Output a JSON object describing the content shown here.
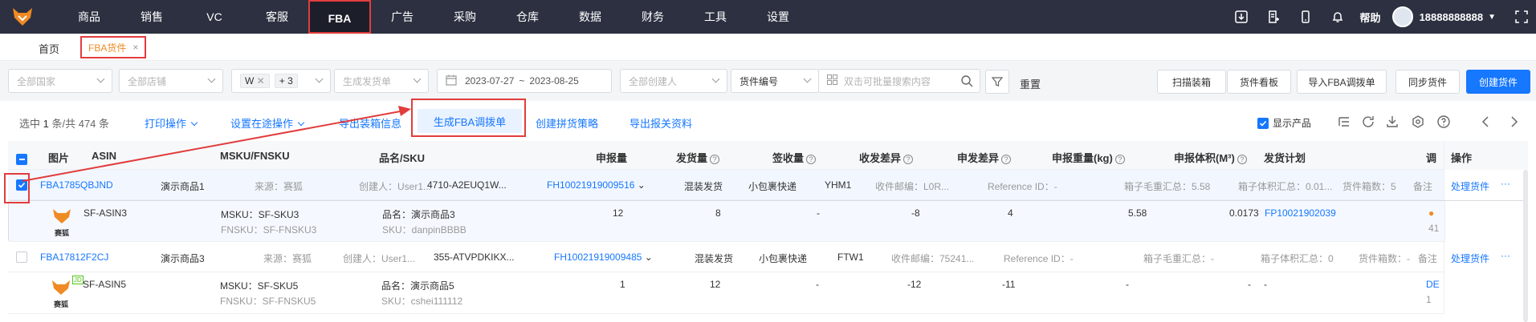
{
  "nav": {
    "items": [
      "商品",
      "销售",
      "VC",
      "客服",
      "FBA",
      "广告",
      "采购",
      "仓库",
      "数据",
      "财务",
      "工具",
      "设置"
    ],
    "active": "FBA",
    "help": "帮助",
    "user": "18888888888"
  },
  "tabs": {
    "home": "首页",
    "current": "FBA货件",
    "close": "×"
  },
  "filters": {
    "country": "全部国家",
    "store": "全部店铺",
    "tag1": "W",
    "tag2": "+ 3",
    "gen_method": "生成发货单",
    "date_start": "2023-07-27",
    "date_sep": "~",
    "date_end": "2023-08-25",
    "creator": "全部创建人",
    "field": "货件编号",
    "search_placeholder": "双击可批量搜索内容",
    "reset": "重置",
    "buttons": [
      "扫描装箱",
      "货件看板",
      "导入FBA调拨单",
      "同步货件"
    ],
    "create": "创建货件"
  },
  "toolbar": {
    "selected_prefix": "选中",
    "selected_count": "1",
    "selected_suffix": "条/共 474 条",
    "print": "打印操作",
    "set_transit": "设置在途操作",
    "export_box": "导出装箱信息",
    "generate": "生成FBA调拨单",
    "create_strategy": "创建拼货策略",
    "export_customs": "导出报关资料",
    "show_products": "显示产品"
  },
  "columns": [
    "图片",
    "ASIN",
    "MSKU/FNSKU",
    "品名/SKU",
    "申报量",
    "发货量",
    "签收量",
    "收发差异",
    "申发差异",
    "申报重量(kg)",
    "申报体积(M³)",
    "发货计划",
    "调",
    "操作"
  ],
  "rows": [
    {
      "shipment_id": "FBA1785QBJND",
      "product_name": "演示商品1",
      "source": "来源：赛狐",
      "creator": "创建人：User1...",
      "msku_code": "4710-A2EUQ1W...",
      "fh_no": "FH10021919009516",
      "ship_type": "混装发货",
      "carrier": "小包裹快递",
      "warehouse": "YHM1",
      "zip": "收件邮编：L0R...",
      "ref": "Reference ID：-",
      "box_weight": "箱子毛重汇总：5.58",
      "box_volume": "箱子体积汇总：0.01...",
      "box_count": "货件箱数：5",
      "note": "备注",
      "op": "处理货件",
      "more": "···",
      "detail": {
        "asin": "SF-ASIN3",
        "msku": "MSKU：SF-SKU3",
        "fnsku": "FNSKU：SF-FNSKU3",
        "name": "品名：演示商品3",
        "sku": "SKU：danpinBBBB",
        "declared": "12",
        "shipped": "8",
        "received": "-",
        "diff_recv": "-8",
        "diff_decl": "4",
        "weight": "5.58",
        "volume": "0.0173",
        "plan": "FP10021902039",
        "adj": "41",
        "logo": "赛狐"
      }
    },
    {
      "shipment_id": "FBA17812F2CJ",
      "product_name": "演示商品3",
      "source": "来源：赛狐",
      "creator": "创建人：User1...",
      "msku_code": "355-ATVPDKIKX...",
      "fh_no": "FH10021919009485",
      "ship_type": "混装发货",
      "carrier": "小包裹快递",
      "warehouse": "FTW1",
      "zip": "收件邮编：75241...",
      "ref": "Reference ID：-",
      "box_weight": "箱子毛重汇总：-",
      "box_volume": "箱子体积汇总：0",
      "box_count": "货件箱数：-",
      "note": "备注",
      "op": "处理货件",
      "more": "···",
      "detail": {
        "asin": "SF-ASIN5",
        "msku": "MSKU：SF-SKU5",
        "fnsku": "FNSKU：SF-FNSKU5",
        "name": "品名：演示商品5",
        "sku": "SKU：cshei111112",
        "declared": "1",
        "shipped": "12",
        "received": "-",
        "diff_recv": "-12",
        "diff_decl": "-11",
        "weight": "-",
        "volume": "-",
        "plan": "-",
        "adj": "DE",
        "adj2": "1",
        "logo": "赛狐",
        "badge": "JD"
      }
    }
  ],
  "colors": {
    "accent": "#1677ff",
    "nav_bg": "#2c3040",
    "highlight": "#e23c3c",
    "orange": "#f08a24"
  }
}
